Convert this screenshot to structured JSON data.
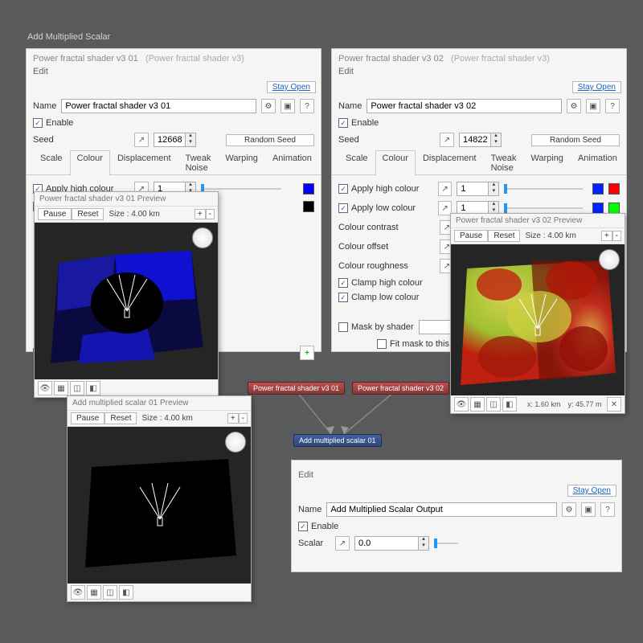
{
  "page_title": "Add Multiplied Scalar",
  "common": {
    "stay_open": "Stay Open",
    "edit": "Edit",
    "name_label": "Name",
    "enable_label": "Enable",
    "seed_label": "Seed",
    "random_seed": "Random Seed",
    "apply_high": "Apply high colour",
    "apply_low": "Apply low colour",
    "colour_contrast": "Colour contrast",
    "colour_offset": "Colour offset",
    "colour_roughness": "Colour roughness",
    "clamp_high": "Clamp high colour",
    "clamp_low": "Clamp low colour",
    "mask_by_shader": "Mask by shader",
    "fit_mask": "Fit mask to this",
    "pause": "Pause",
    "reset": "Reset",
    "plus": "+",
    "minus": "-",
    "scalar_label": "Scalar",
    "tabs": [
      "Scale",
      "Colour",
      "Displacement",
      "Tweak Noise",
      "Warping",
      "Animation"
    ]
  },
  "panel1": {
    "title": "Power fractal shader v3 01",
    "subtitle": "(Power fractal shader v3)",
    "name": "Power fractal shader v3 01",
    "seed": "12668",
    "high_val": "1",
    "high_colour": "#0000ff",
    "low_colour": "#000000",
    "apply_low_checked": false
  },
  "panel2": {
    "title": "Power fractal shader v3 02",
    "subtitle": "(Power fractal shader v3)",
    "name": "Power fractal shader v3 02",
    "seed": "14822",
    "high_val": "1",
    "low_val": "1",
    "high_colour": "#ff0000",
    "high_colour2": "#0022ff",
    "low_colour": "#00ff00",
    "low_colour2": "#0022ff",
    "apply_low_checked": true
  },
  "panel3": {
    "name": "Add Multiplied Scalar Output",
    "scalar": "0.0"
  },
  "preview1": {
    "title": "Power fractal shader v3 01 Preview",
    "size": "Size : 4.00 km"
  },
  "preview2": {
    "title": "Power fractal shader v3 02 Preview",
    "size": "Size : 4.00 km",
    "coords_x": "x: 1.60 km",
    "coords_y": "y: 45.77 m"
  },
  "preview3": {
    "title": "Add multiplied scalar 01 Preview",
    "size": "Size : 4.00 km"
  },
  "nodes": {
    "n1": "Power fractal shader v3 01",
    "n2": "Power fractal shader v3 02",
    "n3": "Add multiplied scalar 01"
  }
}
